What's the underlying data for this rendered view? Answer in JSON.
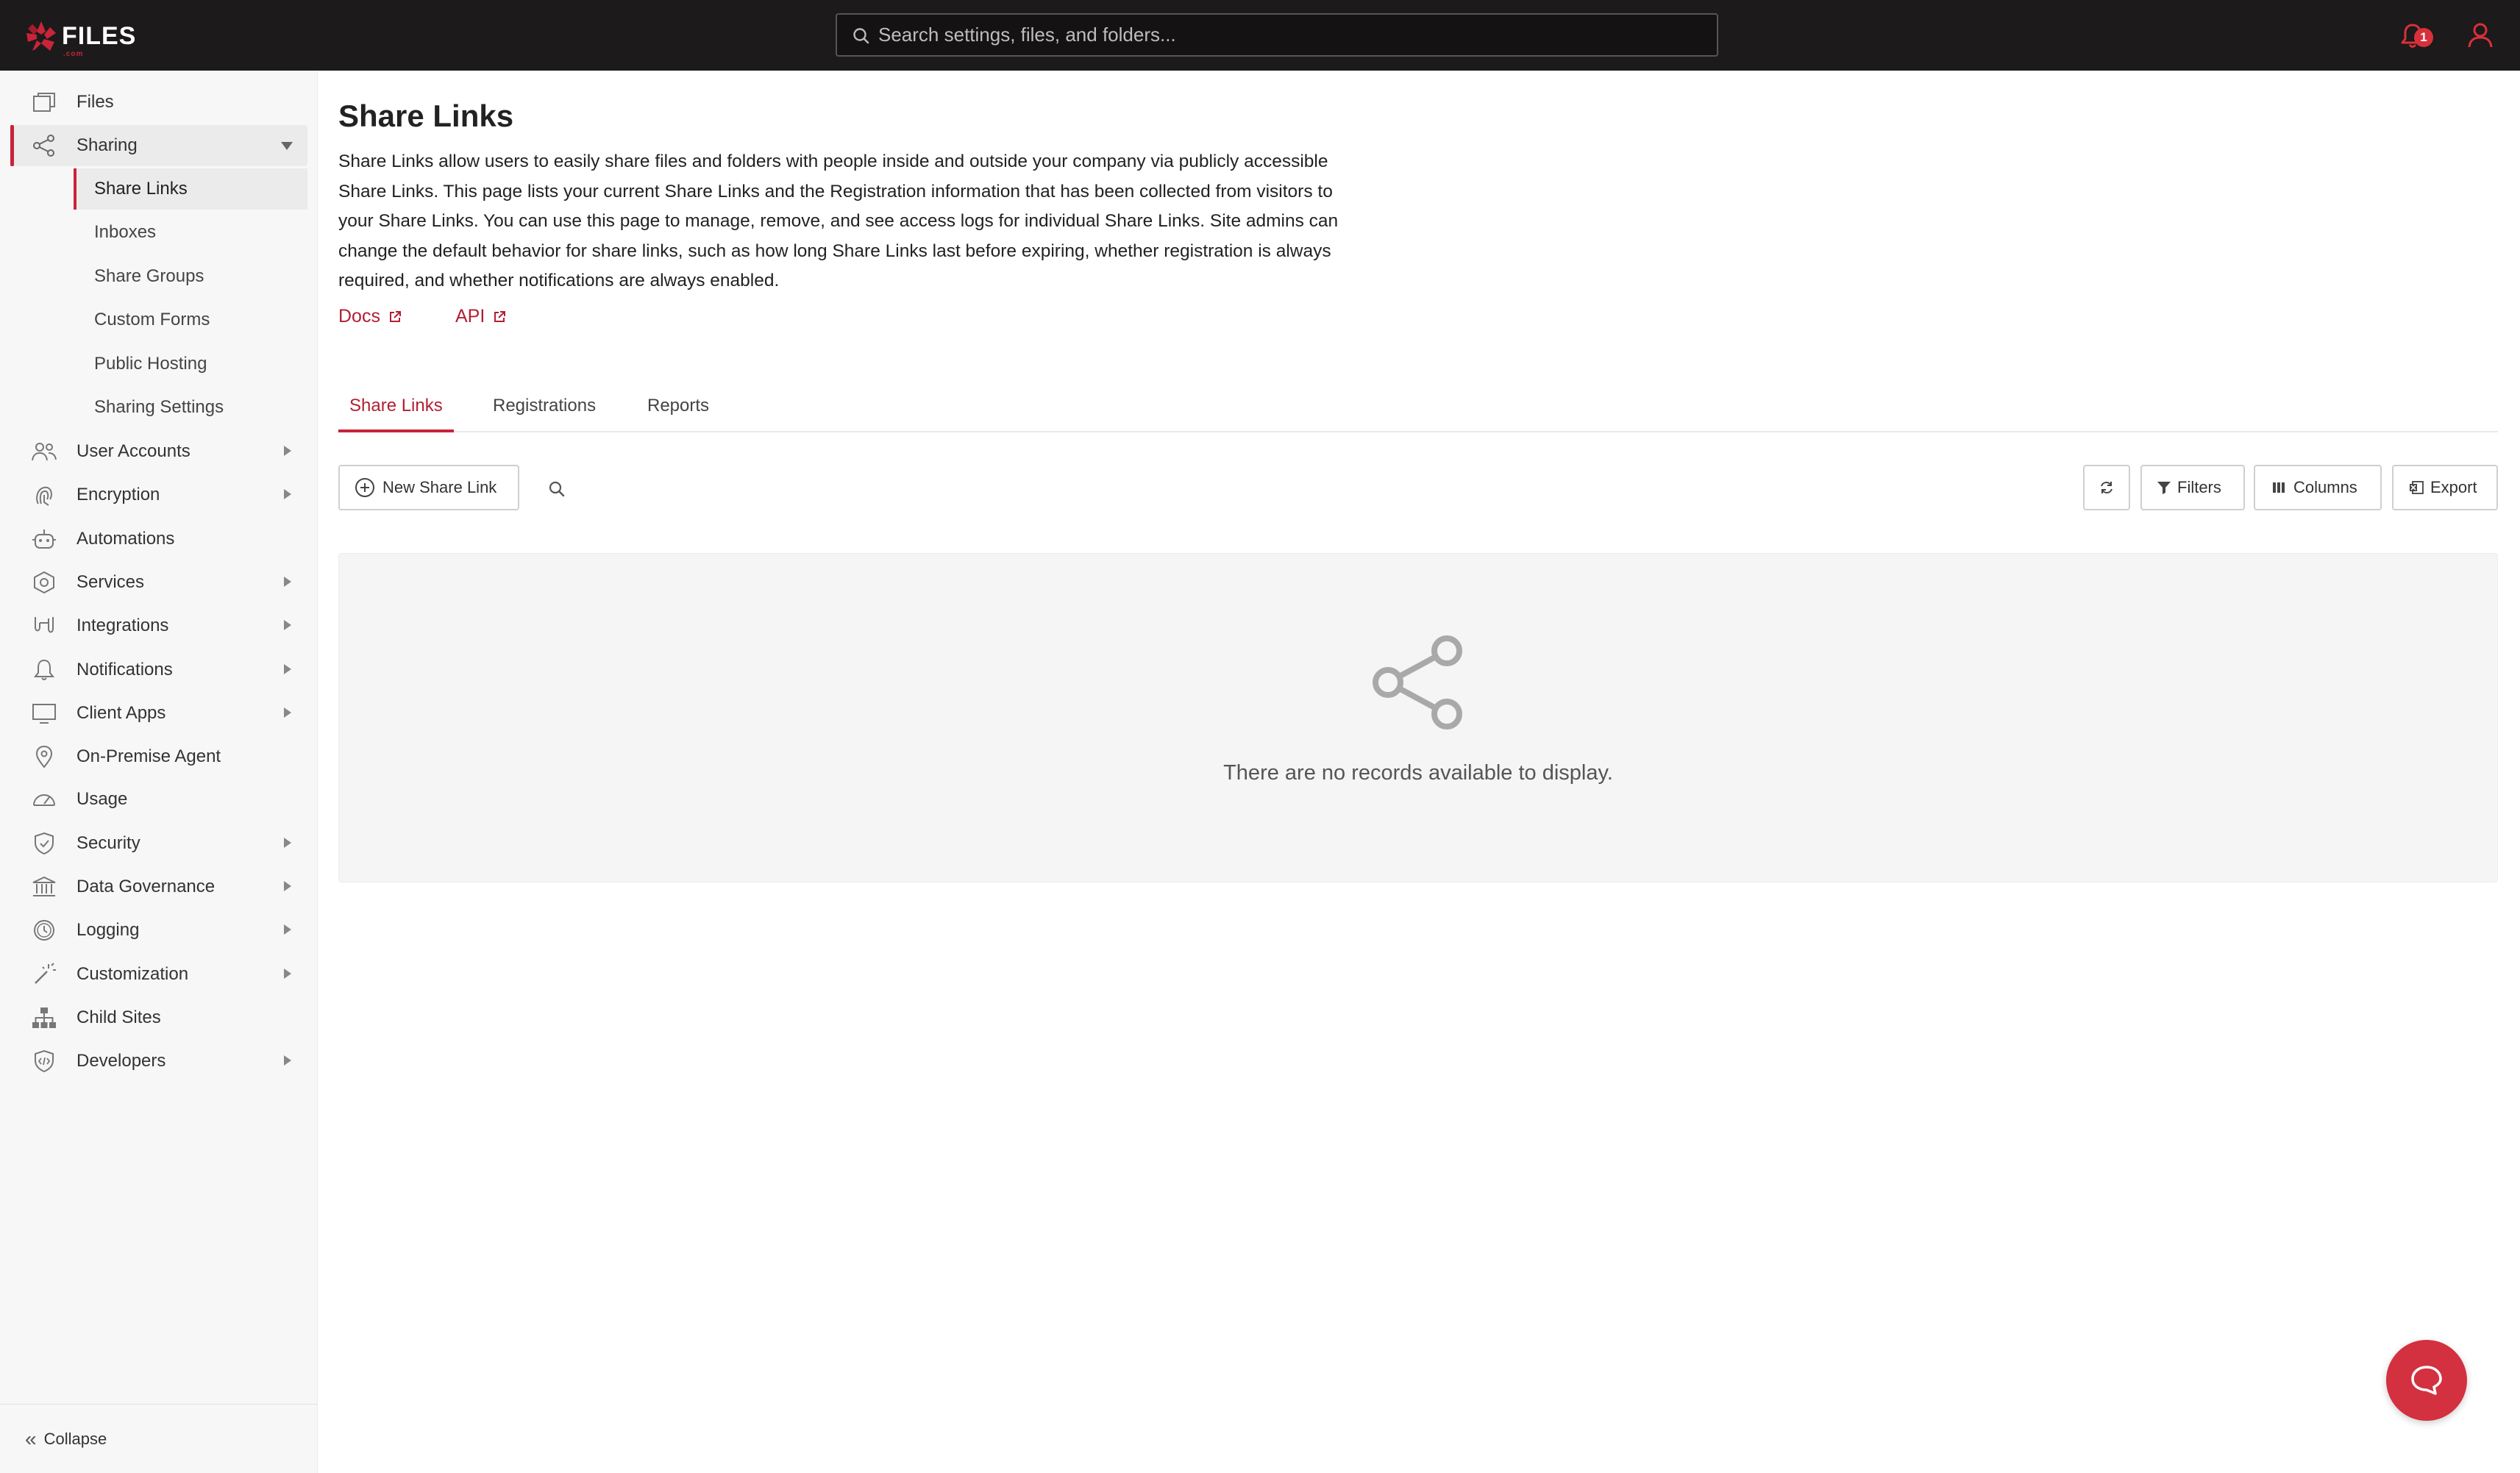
{
  "app": {
    "logo_text": "FILES",
    "logo_sub": ".com"
  },
  "topbar": {
    "search_placeholder": "Search settings, files, and folders...",
    "notification_count": "1"
  },
  "sidebar": {
    "items": [
      {
        "label": "Files",
        "icon": "files-icon"
      },
      {
        "label": "Sharing",
        "icon": "share-icon",
        "expanded": true
      },
      {
        "label": "User Accounts",
        "icon": "users-icon"
      },
      {
        "label": "Encryption",
        "icon": "fingerprint-icon"
      },
      {
        "label": "Automations",
        "icon": "robot-icon"
      },
      {
        "label": "Services",
        "icon": "services-icon"
      },
      {
        "label": "Integrations",
        "icon": "integrations-icon"
      },
      {
        "label": "Notifications",
        "icon": "bell-icon"
      },
      {
        "label": "Client Apps",
        "icon": "monitor-icon"
      },
      {
        "label": "On-Premise Agent",
        "icon": "location-pin-icon"
      },
      {
        "label": "Usage",
        "icon": "gauge-icon"
      },
      {
        "label": "Security",
        "icon": "shield-icon"
      },
      {
        "label": "Data Governance",
        "icon": "bank-icon"
      },
      {
        "label": "Logging",
        "icon": "clock-icon"
      },
      {
        "label": "Customization",
        "icon": "magic-wand-icon"
      },
      {
        "label": "Child Sites",
        "icon": "sitemap-icon"
      },
      {
        "label": "Developers",
        "icon": "code-icon"
      }
    ],
    "sharing_sub": [
      {
        "label": "Share Links",
        "active": true
      },
      {
        "label": "Inboxes"
      },
      {
        "label": "Share Groups"
      },
      {
        "label": "Custom Forms"
      },
      {
        "label": "Public Hosting"
      },
      {
        "label": "Sharing Settings"
      }
    ],
    "collapse_label": "Collapse"
  },
  "main": {
    "title": "Share Links",
    "description": "Share Links allow users to easily share files and folders with people inside and outside your company via publicly accessible Share Links. This page lists your current Share Links and the Registration information that has been collected from visitors to your Share Links. You can use this page to manage, remove, and see access logs for individual Share Links. Site admins can change the default behavior for share links, such as how long Share Links last before expiring, whether registration is always required, and whether notifications are always enabled.",
    "links": {
      "docs": "Docs",
      "api": "API"
    },
    "tabs": [
      {
        "label": "Share Links",
        "active": true
      },
      {
        "label": "Registrations"
      },
      {
        "label": "Reports"
      }
    ],
    "toolbar": {
      "new_label": "New Share Link",
      "filters_label": "Filters",
      "columns_label": "Columns",
      "export_label": "Export"
    },
    "empty_message": "There are no records available to display."
  },
  "colors": {
    "accent": "#c8243a",
    "topbar": "#1c1a1b",
    "sidebar": "#f7f7f7"
  }
}
